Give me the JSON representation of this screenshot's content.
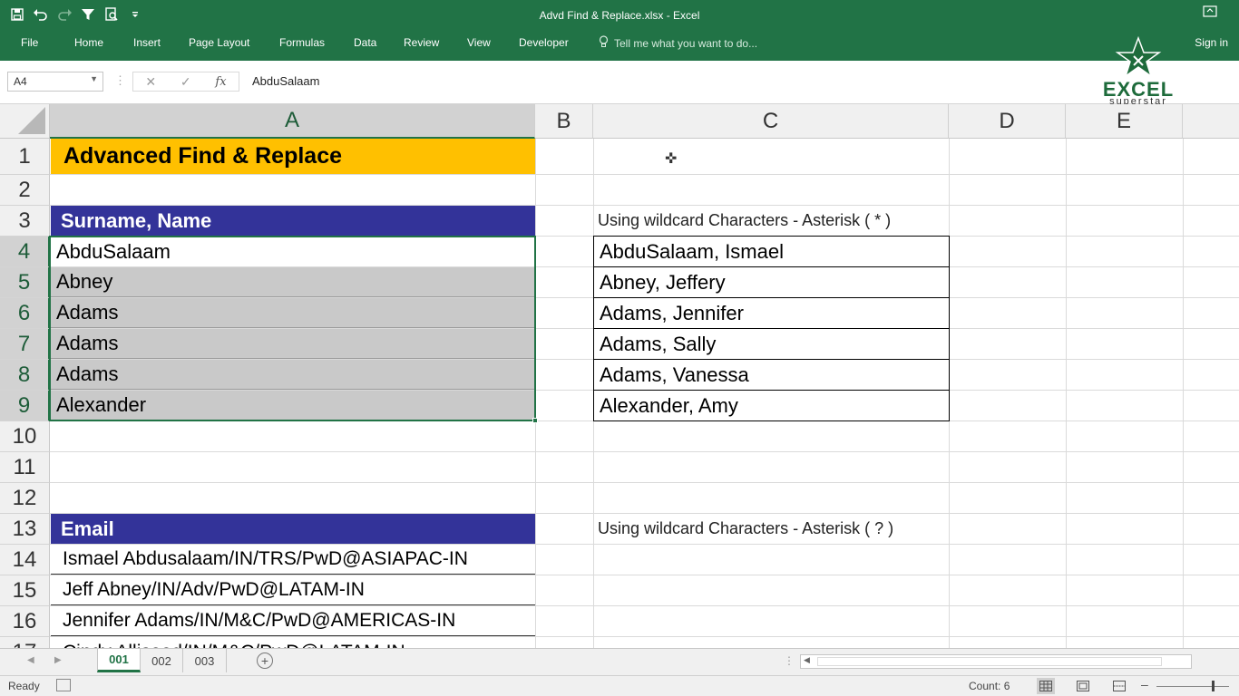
{
  "titlebar": {
    "title": "Advd Find & Replace.xlsx - Excel"
  },
  "ribbon": {
    "tabs": [
      "File",
      "Home",
      "Insert",
      "Page Layout",
      "Formulas",
      "Data",
      "Review",
      "View",
      "Developer"
    ],
    "tell_me": "Tell me what you want to do...",
    "sign_in": "Sign in"
  },
  "formula_bar": {
    "name_box": "A4",
    "fx": "fx",
    "formula": "AbduSalaam"
  },
  "logo": {
    "main": "EXCEL",
    "sub": "superstar"
  },
  "columns": [
    "A",
    "B",
    "C",
    "D",
    "E"
  ],
  "rows": [
    "1",
    "2",
    "3",
    "4",
    "5",
    "6",
    "7",
    "8",
    "9",
    "10",
    "11",
    "12",
    "13",
    "14",
    "15",
    "16",
    "17"
  ],
  "cells": {
    "A1": "Advanced Find & Replace",
    "A3": "Surname, Name",
    "A4": "AbduSalaam",
    "A5": "Abney",
    "A6": "Adams",
    "A7": "Adams",
    "A8": "Adams",
    "A9": "Alexander",
    "A13": "Email",
    "A14": "Ismael Abdusalaam/IN/TRS/PwD@ASIAPAC-IN",
    "A15": "Jeff Abney/IN/Adv/PwD@LATAM-IN",
    "A16": "Jennifer Adams/IN/M&C/PwD@AMERICAS-IN",
    "A17": "Cindy Allisood/IN/M&C/PwD@LATAM-IN",
    "C3": "Using wildcard Characters - Asterisk ( * )",
    "C4": "AbduSalaam, Ismael",
    "C5": "Abney, Jeffery",
    "C6": "Adams, Jennifer",
    "C7": "Adams, Sally",
    "C8": "Adams, Vanessa",
    "C9": "Alexander, Amy",
    "C13": "Using wildcard Characters - Asterisk ( ? )"
  },
  "sheets": [
    "001",
    "002",
    "003"
  ],
  "active_sheet": "001",
  "status": {
    "ready": "Ready",
    "count": "Count: 6"
  },
  "colors": {
    "excel_green": "#217346",
    "title_fill": "#ffc000",
    "header_fill": "#333399",
    "selection_fill": "#c9c9c9"
  },
  "icons": [
    "save-icon",
    "undo-icon",
    "redo-icon",
    "filter-icon",
    "print-preview-icon",
    "customize-qat-icon",
    "lightbulb-icon",
    "ribbon-display-icon",
    "cancel-icon",
    "enter-icon",
    "fx-icon",
    "new-sheet-icon",
    "macro-record-icon",
    "normal-view-icon",
    "page-layout-view-icon",
    "page-break-view-icon"
  ]
}
